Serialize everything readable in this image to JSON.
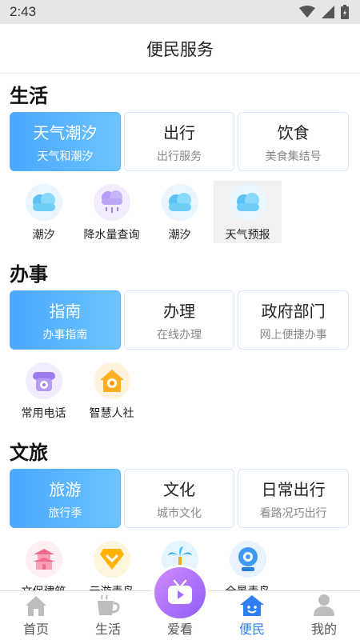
{
  "status_bar": {
    "time": "2:43"
  },
  "header": {
    "title": "便民服务"
  },
  "sections": [
    {
      "title": "生活",
      "cards": [
        {
          "title": "天气潮汐",
          "subtitle": "天气和潮汐"
        },
        {
          "title": "出行",
          "subtitle": "出行服务"
        },
        {
          "title": "饮食",
          "subtitle": "美食集结号"
        }
      ],
      "items": [
        {
          "label": "潮汐",
          "icon": "cloud-icon"
        },
        {
          "label": "降水量查询",
          "icon": "rain-cloud-icon"
        },
        {
          "label": "潮汐",
          "icon": "cloud-icon"
        },
        {
          "label": "天气预报",
          "icon": "cloud-icon"
        }
      ]
    },
    {
      "title": "办事",
      "cards": [
        {
          "title": "指南",
          "subtitle": "办事指南"
        },
        {
          "title": "办理",
          "subtitle": "在线办理"
        },
        {
          "title": "政府部门",
          "subtitle": "网上便捷办事"
        }
      ],
      "items": [
        {
          "label": "常用电话",
          "icon": "telephone-icon"
        },
        {
          "label": "智慧人社",
          "icon": "house-icon"
        }
      ]
    },
    {
      "title": "文旅",
      "cards": [
        {
          "title": "旅游",
          "subtitle": "旅行季"
        },
        {
          "title": "文化",
          "subtitle": "城市文化"
        },
        {
          "title": "日常出行",
          "subtitle": "看路况巧出行"
        }
      ],
      "items": [
        {
          "label": "文保建筑",
          "icon": "pagoda-icon"
        },
        {
          "label": "云游青岛",
          "icon": "chevron-badge-icon"
        },
        {
          "label": "",
          "icon": "palm-tree-icon"
        },
        {
          "label": "全景青岛",
          "icon": "camera-icon"
        }
      ]
    }
  ],
  "bottom_nav": {
    "items": [
      {
        "label": "首页",
        "icon": "home-icon"
      },
      {
        "label": "生活",
        "icon": "coffee-cup-icon"
      },
      {
        "label": "爱看",
        "icon": "tv-play-icon"
      },
      {
        "label": "便民",
        "icon": "smile-house-icon"
      },
      {
        "label": "我的",
        "icon": "user-icon"
      }
    ],
    "active": "便民"
  },
  "colors": {
    "accent": "#2f7ff0",
    "active_card": "#4aa7ff",
    "fab": "#a66ef8"
  }
}
